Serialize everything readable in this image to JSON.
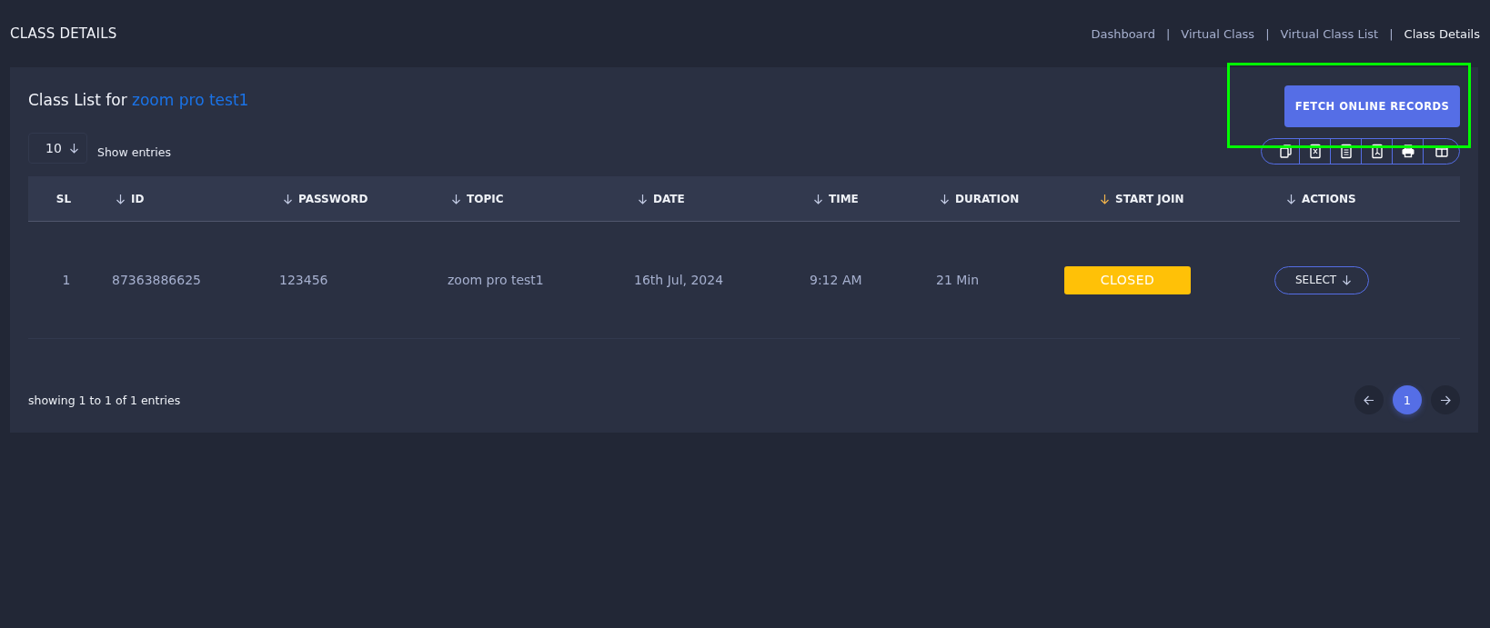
{
  "page_title": "CLASS DETAILS",
  "breadcrumbs": [
    {
      "label": "Dashboard",
      "selected": false
    },
    {
      "separator": "|",
      "label": "Virtual Class",
      "selected": false
    },
    {
      "separator": "|",
      "label": "Virtual Class List",
      "selected": false
    },
    {
      "separator": "|",
      "label": "Class Details",
      "selected": true
    }
  ],
  "card": {
    "title_prefix": "Class List for",
    "title_highlight": "zoom pro test1",
    "fetch_button": "FETCH ONLINE RECORDS",
    "page_length": {
      "value": "10",
      "label": "Show entries"
    }
  },
  "table": {
    "columns": [
      {
        "label": "SL",
        "sortable": false
      },
      {
        "label": "ID",
        "sortable": true
      },
      {
        "label": "PASSWORD",
        "sortable": true
      },
      {
        "label": "TOPIC",
        "sortable": true
      },
      {
        "label": "DATE",
        "sortable": true
      },
      {
        "label": "TIME",
        "sortable": true
      },
      {
        "label": "DURATION",
        "sortable": true
      },
      {
        "label": "START JOIN",
        "sortable": true
      },
      {
        "label": "ACTIONS",
        "sortable": true
      }
    ],
    "rows": [
      {
        "sl": "1",
        "id": "87363886625",
        "password": "123456",
        "topic": "zoom pro test1",
        "date": "16th Jul, 2024",
        "time": "9:12 AM",
        "duration": "21 Min",
        "status": {
          "label": "CLOSED",
          "kind": "closed"
        },
        "action": "SELECT"
      }
    ]
  },
  "footer": {
    "info": "showing 1 to 1 of 1 entries",
    "pages": [
      {
        "label": "1",
        "selected": true
      }
    ]
  },
  "highlight_frame": true
}
